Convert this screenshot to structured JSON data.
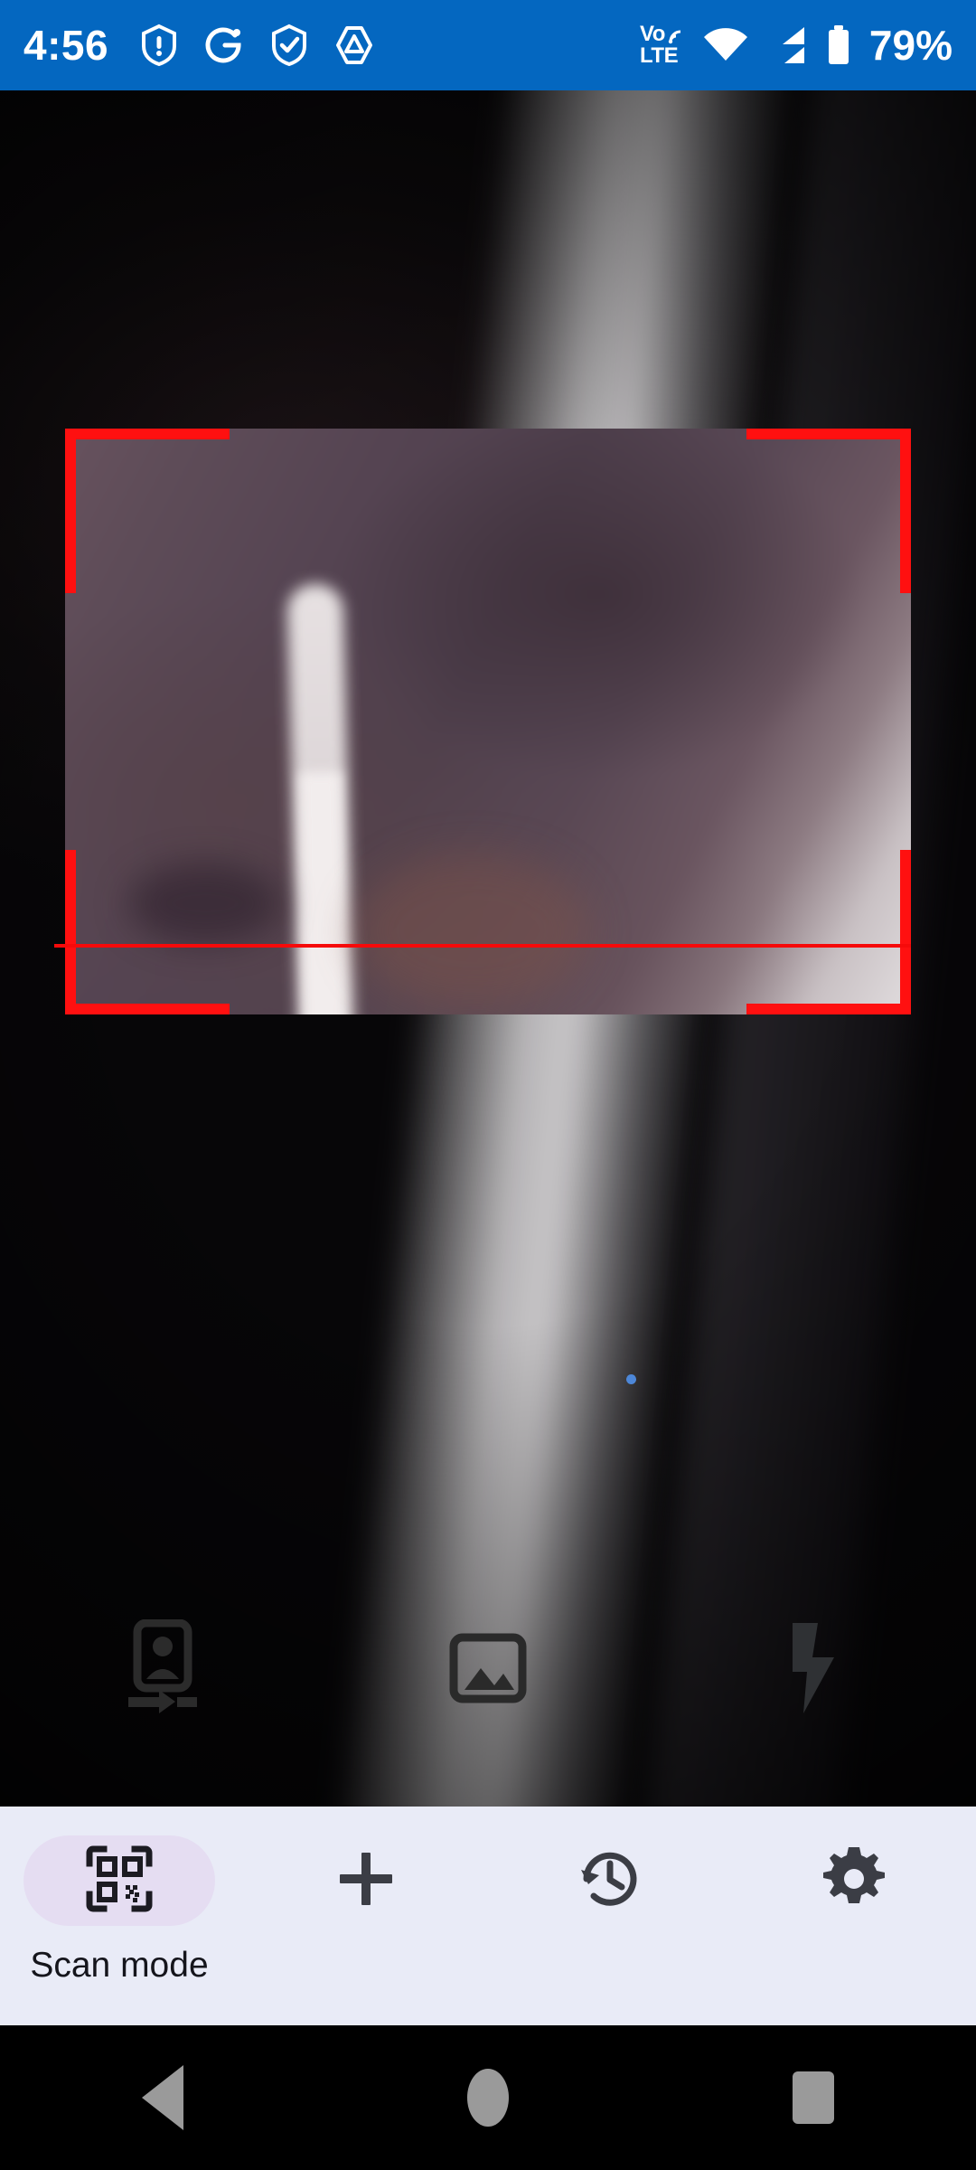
{
  "status_bar": {
    "time": "4:56",
    "battery_percent": "79%",
    "volte_top": "Vo",
    "volte_bottom": "LTE",
    "background_color": "#0467C0",
    "left_icons": [
      {
        "name": "shield-alert-icon"
      },
      {
        "name": "g-circle-icon"
      },
      {
        "name": "shield-check-icon"
      },
      {
        "name": "triangle-hexagon-icon"
      }
    ],
    "right_icons": [
      {
        "name": "volte-icon"
      },
      {
        "name": "wifi-icon"
      },
      {
        "name": "cellular-signal-icon"
      },
      {
        "name": "battery-icon"
      }
    ]
  },
  "camera": {
    "viewfinder": {
      "corner_color": "#FF1010",
      "scan_line_color": "#F60A0A",
      "focus_dot_color": "#4D87D8"
    },
    "overlay_controls": [
      {
        "name": "switch-camera-icon",
        "label": "Switch camera"
      },
      {
        "name": "gallery-icon",
        "label": "Gallery"
      },
      {
        "name": "flash-icon",
        "label": "Flash"
      }
    ]
  },
  "bottom_panel": {
    "background_color": "#E9EBF7",
    "scan_mode": {
      "label": "Scan mode",
      "icon": "qr-code-icon",
      "pill_color": "#E5DDF2",
      "selected": true
    },
    "actions": [
      {
        "name": "add-button",
        "icon": "plus-icon",
        "label": "Add"
      },
      {
        "name": "history-button",
        "icon": "history-icon",
        "label": "History"
      },
      {
        "name": "settings-button",
        "icon": "gear-icon",
        "label": "Settings"
      }
    ]
  },
  "nav_bar": {
    "buttons": [
      {
        "name": "back-button",
        "icon": "triangle-left-icon"
      },
      {
        "name": "home-button",
        "icon": "circle-icon"
      },
      {
        "name": "recents-button",
        "icon": "square-icon"
      }
    ]
  }
}
